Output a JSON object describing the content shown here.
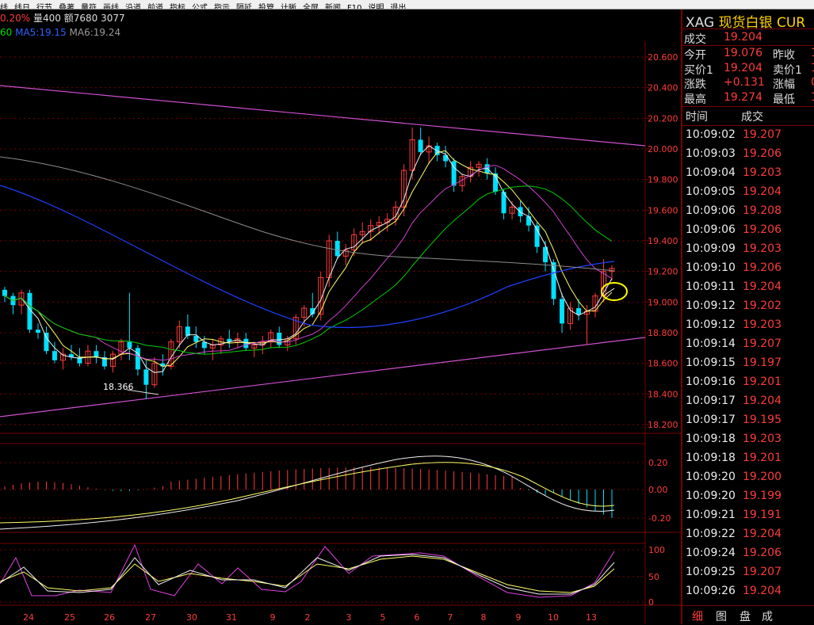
{
  "menu": [
    "线",
    "线日",
    "行节",
    "叠著",
    "量符",
    "画线",
    "沿道",
    "前道",
    "指标",
    "公式",
    "指示",
    "隔延",
    "投管",
    "计晰",
    "全屏",
    "新闻",
    "F10",
    "说明",
    "退出"
  ],
  "info_bar": {
    "change_pct": "0.20%",
    "volume": "量400",
    "amount": "额7680",
    "extra": "3077"
  },
  "ma_legend": [
    {
      "label": "60",
      "color": "#00e000"
    },
    {
      "label": "MA5:19.15",
      "color": "#3060ff"
    },
    {
      "label": "MA6:19.24",
      "color": "#9a9a9a"
    }
  ],
  "main_axis": [
    "20.600",
    "20.400",
    "20.200",
    "20.000",
    "19.800",
    "19.600",
    "19.400",
    "19.200",
    "19.000",
    "18.800",
    "18.600",
    "18.400",
    "18.200"
  ],
  "macd_axis": [
    "0.20",
    "0.00",
    "-0.20"
  ],
  "kdj_axis": [
    "100",
    "50",
    "0"
  ],
  "low_label": "18.366",
  "x_axis": [
    "24",
    "25",
    "26",
    "27",
    "30",
    "31",
    "9",
    "2",
    "3",
    "5",
    "6",
    "7",
    "8",
    "9",
    "10",
    "13"
  ],
  "quote": {
    "symbol": "XAG",
    "name": "现货白银",
    "code": "CUR",
    "deal_label": "成交",
    "deal": "19.204",
    "open_label": "今开",
    "open": "19.076",
    "prev_label": "昨收",
    "prev": "1",
    "bid_label": "买价1",
    "bid": "19.204",
    "ask_label": "卖价1",
    "ask": "1",
    "chg_label": "涨跌",
    "chg": "+0.131",
    "amp_label": "涨幅",
    "amp": "0",
    "high_label": "最高",
    "high": "19.274",
    "low_label": "最低",
    "low": "1"
  },
  "ticks_header": {
    "time": "时间",
    "deal": "成交"
  },
  "ticks": [
    {
      "time": "10:09:02",
      "price": "19.207"
    },
    {
      "time": "10:09:03",
      "price": "19.206"
    },
    {
      "time": "10:09:04",
      "price": "19.203"
    },
    {
      "time": "10:09:05",
      "price": "19.204"
    },
    {
      "time": "10:09:06",
      "price": "19.208"
    },
    {
      "time": "10:09:06",
      "price": "19.206"
    },
    {
      "time": "10:09:09",
      "price": "19.203"
    },
    {
      "time": "10:09:10",
      "price": "19.206"
    },
    {
      "time": "10:09:11",
      "price": "19.204"
    },
    {
      "time": "10:09:12",
      "price": "19.202"
    },
    {
      "time": "10:09:12",
      "price": "19.203"
    },
    {
      "time": "10:09:14",
      "price": "19.207"
    },
    {
      "time": "10:09:15",
      "price": "19.197"
    },
    {
      "time": "10:09:16",
      "price": "19.201"
    },
    {
      "time": "10:09:17",
      "price": "19.204"
    },
    {
      "time": "10:09:17",
      "price": "19.195"
    },
    {
      "time": "10:09:18",
      "price": "19.203"
    },
    {
      "time": "10:09:18",
      "price": "19.201"
    },
    {
      "time": "10:09:20",
      "price": "19.200"
    },
    {
      "time": "10:09:20",
      "price": "19.199"
    },
    {
      "time": "10:09:21",
      "price": "19.191"
    },
    {
      "time": "10:09:22",
      "price": "19.204"
    },
    {
      "time": "10:09:24",
      "price": "19.206"
    },
    {
      "time": "10:09:25",
      "price": "19.207"
    },
    {
      "time": "10:09:26",
      "price": "19.204"
    }
  ],
  "tabs": [
    "细",
    "图",
    "盘",
    "成"
  ],
  "colors": {
    "up": "#ff3b3b",
    "down": "#00e0ff",
    "grid": "#7a0000",
    "ma_yellow": "#ffff66",
    "ma_white": "#f0f0f0",
    "ma_green": "#00d000",
    "ma_magenta": "#d040d0",
    "ma_blue": "#2040ff",
    "ma_gray": "#8c8c8c",
    "trend": "#d050d0",
    "highlight": "#ffff00"
  },
  "chart_data": {
    "type": "candlestick",
    "series": [
      {
        "name": "K",
        "values": [
          [
            19.08,
            19.1,
            19.0,
            19.04
          ],
          [
            19.04,
            19.06,
            18.92,
            18.98
          ],
          [
            18.98,
            19.08,
            18.92,
            19.06
          ],
          [
            19.06,
            19.08,
            18.8,
            18.82
          ],
          [
            18.82,
            18.86,
            18.76,
            18.8
          ],
          [
            18.8,
            18.84,
            18.66,
            18.68
          ],
          [
            18.68,
            18.74,
            18.6,
            18.62
          ],
          [
            18.62,
            18.7,
            18.56,
            18.66
          ],
          [
            18.66,
            18.72,
            18.62,
            18.64
          ],
          [
            18.64,
            18.7,
            18.58,
            18.6
          ],
          [
            18.6,
            18.72,
            18.58,
            18.68
          ],
          [
            18.68,
            18.72,
            18.6,
            18.64
          ],
          [
            18.64,
            18.68,
            18.56,
            18.58
          ],
          [
            18.58,
            18.68,
            18.54,
            18.66
          ],
          [
            18.66,
            18.76,
            18.62,
            18.74
          ],
          [
            18.74,
            19.06,
            18.62,
            18.7
          ],
          [
            18.7,
            18.72,
            18.52,
            18.56
          ],
          [
            18.56,
            18.62,
            18.366,
            18.46
          ],
          [
            18.46,
            18.64,
            18.44,
            18.6
          ],
          [
            18.6,
            18.66,
            18.52,
            18.58
          ],
          [
            18.58,
            18.76,
            18.56,
            18.74
          ],
          [
            18.74,
            18.88,
            18.7,
            18.84
          ],
          [
            18.84,
            18.92,
            18.76,
            18.78
          ],
          [
            18.78,
            18.84,
            18.7,
            18.74
          ],
          [
            18.74,
            18.78,
            18.66,
            18.7
          ],
          [
            18.7,
            18.76,
            18.62,
            18.72
          ],
          [
            18.72,
            18.78,
            18.66,
            18.76
          ],
          [
            18.76,
            18.82,
            18.7,
            18.74
          ],
          [
            18.74,
            18.8,
            18.7,
            18.76
          ],
          [
            18.76,
            18.8,
            18.68,
            18.7
          ],
          [
            18.7,
            18.74,
            18.64,
            18.72
          ],
          [
            18.72,
            18.78,
            18.66,
            18.74
          ],
          [
            18.74,
            18.82,
            18.7,
            18.8
          ],
          [
            18.8,
            18.84,
            18.7,
            18.72
          ],
          [
            18.72,
            18.78,
            18.68,
            18.76
          ],
          [
            18.76,
            18.92,
            18.72,
            18.9
          ],
          [
            18.9,
            18.98,
            18.84,
            18.96
          ],
          [
            18.96,
            19.06,
            18.9,
            18.92
          ],
          [
            18.92,
            19.2,
            18.88,
            19.16
          ],
          [
            19.16,
            19.44,
            19.1,
            19.4
          ],
          [
            19.4,
            19.46,
            19.28,
            19.3
          ],
          [
            19.3,
            19.38,
            19.24,
            19.34
          ],
          [
            19.34,
            19.48,
            19.3,
            19.44
          ],
          [
            19.44,
            19.52,
            19.38,
            19.46
          ],
          [
            19.46,
            19.54,
            19.4,
            19.5
          ],
          [
            19.5,
            19.56,
            19.44,
            19.52
          ],
          [
            19.52,
            19.58,
            19.46,
            19.54
          ],
          [
            19.54,
            19.66,
            19.5,
            19.62
          ],
          [
            19.62,
            19.9,
            19.56,
            19.86
          ],
          [
            19.86,
            20.14,
            19.8,
            20.06
          ],
          [
            20.06,
            20.14,
            19.96,
            19.98
          ],
          [
            19.98,
            20.08,
            19.9,
            20.02
          ],
          [
            20.02,
            20.04,
            19.92,
            19.96
          ],
          [
            19.96,
            20.02,
            19.88,
            19.92
          ],
          [
            19.92,
            19.94,
            19.72,
            19.76
          ],
          [
            19.76,
            19.84,
            19.72,
            19.82
          ],
          [
            19.82,
            19.92,
            19.78,
            19.88
          ],
          [
            19.88,
            19.92,
            19.82,
            19.9
          ],
          [
            19.9,
            19.94,
            19.8,
            19.84
          ],
          [
            19.84,
            19.88,
            19.7,
            19.72
          ],
          [
            19.72,
            19.74,
            19.54,
            19.58
          ],
          [
            19.58,
            19.66,
            19.54,
            19.62
          ],
          [
            19.62,
            19.66,
            19.52,
            19.56
          ],
          [
            19.56,
            19.62,
            19.46,
            19.5
          ],
          [
            19.5,
            19.52,
            19.32,
            19.36
          ],
          [
            19.36,
            19.4,
            19.2,
            19.26
          ],
          [
            19.26,
            19.28,
            18.98,
            19.02
          ],
          [
            19.02,
            19.06,
            18.8,
            18.86
          ],
          [
            18.86,
            19.0,
            18.82,
            18.96
          ],
          [
            18.96,
            19.02,
            18.88,
            18.92
          ],
          [
            18.92,
            18.98,
            18.72,
            18.94
          ],
          [
            18.94,
            19.06,
            18.9,
            19.04
          ],
          [
            19.04,
            19.28,
            19.0,
            19.2
          ],
          [
            19.2,
            19.24,
            19.14,
            19.22
          ]
        ]
      }
    ],
    "ylim": [
      18.2,
      20.6
    ]
  }
}
